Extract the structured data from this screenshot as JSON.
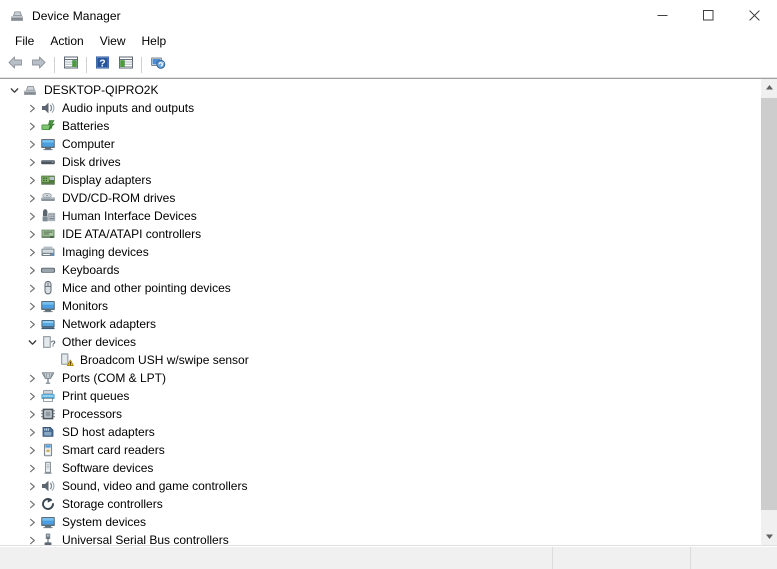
{
  "window": {
    "title": "Device Manager",
    "icon": "device-manager-icon",
    "buttons": {
      "minimize": "─",
      "maximize": "□",
      "close": "✕"
    }
  },
  "menubar": {
    "items": [
      {
        "label": "File",
        "name": "menu-file"
      },
      {
        "label": "Action",
        "name": "menu-action"
      },
      {
        "label": "View",
        "name": "menu-view"
      },
      {
        "label": "Help",
        "name": "menu-help"
      }
    ]
  },
  "toolbar": {
    "items": [
      {
        "name": "back-icon",
        "type": "icon",
        "tooltip": "Back"
      },
      {
        "name": "forward-icon",
        "type": "icon",
        "tooltip": "Forward"
      },
      {
        "name": "separator-1",
        "type": "separator"
      },
      {
        "name": "show-hide-console-tree-icon",
        "type": "icon",
        "tooltip": "Show/Hide Console Tree"
      },
      {
        "name": "separator-2",
        "type": "separator"
      },
      {
        "name": "help-icon",
        "type": "icon",
        "tooltip": "Help"
      },
      {
        "name": "properties-icon",
        "type": "icon",
        "tooltip": "Properties"
      },
      {
        "name": "separator-3",
        "type": "separator"
      },
      {
        "name": "scan-for-hardware-changes-icon",
        "type": "icon",
        "tooltip": "Scan for hardware changes"
      }
    ]
  },
  "tree": {
    "root": {
      "label": "DESKTOP-QIPRO2K",
      "icon": "computer-root-icon",
      "expanded": true,
      "indent": 0
    },
    "items": [
      {
        "label": "Audio inputs and outputs",
        "icon": "speaker-icon",
        "expanded": false,
        "indent": 1,
        "hasChildren": true
      },
      {
        "label": "Batteries",
        "icon": "battery-icon",
        "expanded": false,
        "indent": 1,
        "hasChildren": true
      },
      {
        "label": "Computer",
        "icon": "monitor-icon",
        "expanded": false,
        "indent": 1,
        "hasChildren": true
      },
      {
        "label": "Disk drives",
        "icon": "disk-drive-icon",
        "expanded": false,
        "indent": 1,
        "hasChildren": true
      },
      {
        "label": "Display adapters",
        "icon": "display-adapter-icon",
        "expanded": false,
        "indent": 1,
        "hasChildren": true
      },
      {
        "label": "DVD/CD-ROM drives",
        "icon": "optical-drive-icon",
        "expanded": false,
        "indent": 1,
        "hasChildren": true
      },
      {
        "label": "Human Interface Devices",
        "icon": "hid-icon",
        "expanded": false,
        "indent": 1,
        "hasChildren": true
      },
      {
        "label": "IDE ATA/ATAPI controllers",
        "icon": "ide-controller-icon",
        "expanded": false,
        "indent": 1,
        "hasChildren": true
      },
      {
        "label": "Imaging devices",
        "icon": "imaging-device-icon",
        "expanded": false,
        "indent": 1,
        "hasChildren": true
      },
      {
        "label": "Keyboards",
        "icon": "keyboard-icon",
        "expanded": false,
        "indent": 1,
        "hasChildren": true
      },
      {
        "label": "Mice and other pointing devices",
        "icon": "mouse-icon",
        "expanded": false,
        "indent": 1,
        "hasChildren": true
      },
      {
        "label": "Monitors",
        "icon": "monitor-icon",
        "expanded": false,
        "indent": 1,
        "hasChildren": true
      },
      {
        "label": "Network adapters",
        "icon": "network-adapter-icon",
        "expanded": false,
        "indent": 1,
        "hasChildren": true
      },
      {
        "label": "Other devices",
        "icon": "other-device-icon",
        "expanded": true,
        "indent": 1,
        "hasChildren": true
      },
      {
        "label": "Broadcom USH w/swipe sensor",
        "icon": "unknown-device-warning-icon",
        "expanded": false,
        "indent": 2,
        "hasChildren": false,
        "warning": true
      },
      {
        "label": "Ports (COM & LPT)",
        "icon": "port-icon",
        "expanded": false,
        "indent": 1,
        "hasChildren": true
      },
      {
        "label": "Print queues",
        "icon": "printer-icon",
        "expanded": false,
        "indent": 1,
        "hasChildren": true
      },
      {
        "label": "Processors",
        "icon": "processor-icon",
        "expanded": false,
        "indent": 1,
        "hasChildren": true
      },
      {
        "label": "SD host adapters",
        "icon": "sd-host-adapter-icon",
        "expanded": false,
        "indent": 1,
        "hasChildren": true
      },
      {
        "label": "Smart card readers",
        "icon": "smart-card-reader-icon",
        "expanded": false,
        "indent": 1,
        "hasChildren": true
      },
      {
        "label": "Software devices",
        "icon": "software-device-icon",
        "expanded": false,
        "indent": 1,
        "hasChildren": true
      },
      {
        "label": "Sound, video and game controllers",
        "icon": "sound-controller-icon",
        "expanded": false,
        "indent": 1,
        "hasChildren": true
      },
      {
        "label": "Storage controllers",
        "icon": "storage-controller-icon",
        "expanded": false,
        "indent": 1,
        "hasChildren": true
      },
      {
        "label": "System devices",
        "icon": "system-device-icon",
        "expanded": false,
        "indent": 1,
        "hasChildren": true
      },
      {
        "label": "Universal Serial Bus controllers",
        "icon": "usb-controller-icon",
        "expanded": false,
        "indent": 1,
        "hasChildren": true
      }
    ]
  },
  "statusbar": {
    "panes": [
      "",
      "",
      ""
    ]
  },
  "colors": {
    "accent_blue": "#1f5da0",
    "icon_blue": "#4a90d9",
    "warning_yellow": "#f5c518",
    "window_bg": "#ffffff",
    "chrome_bg": "#f0f0f0"
  }
}
